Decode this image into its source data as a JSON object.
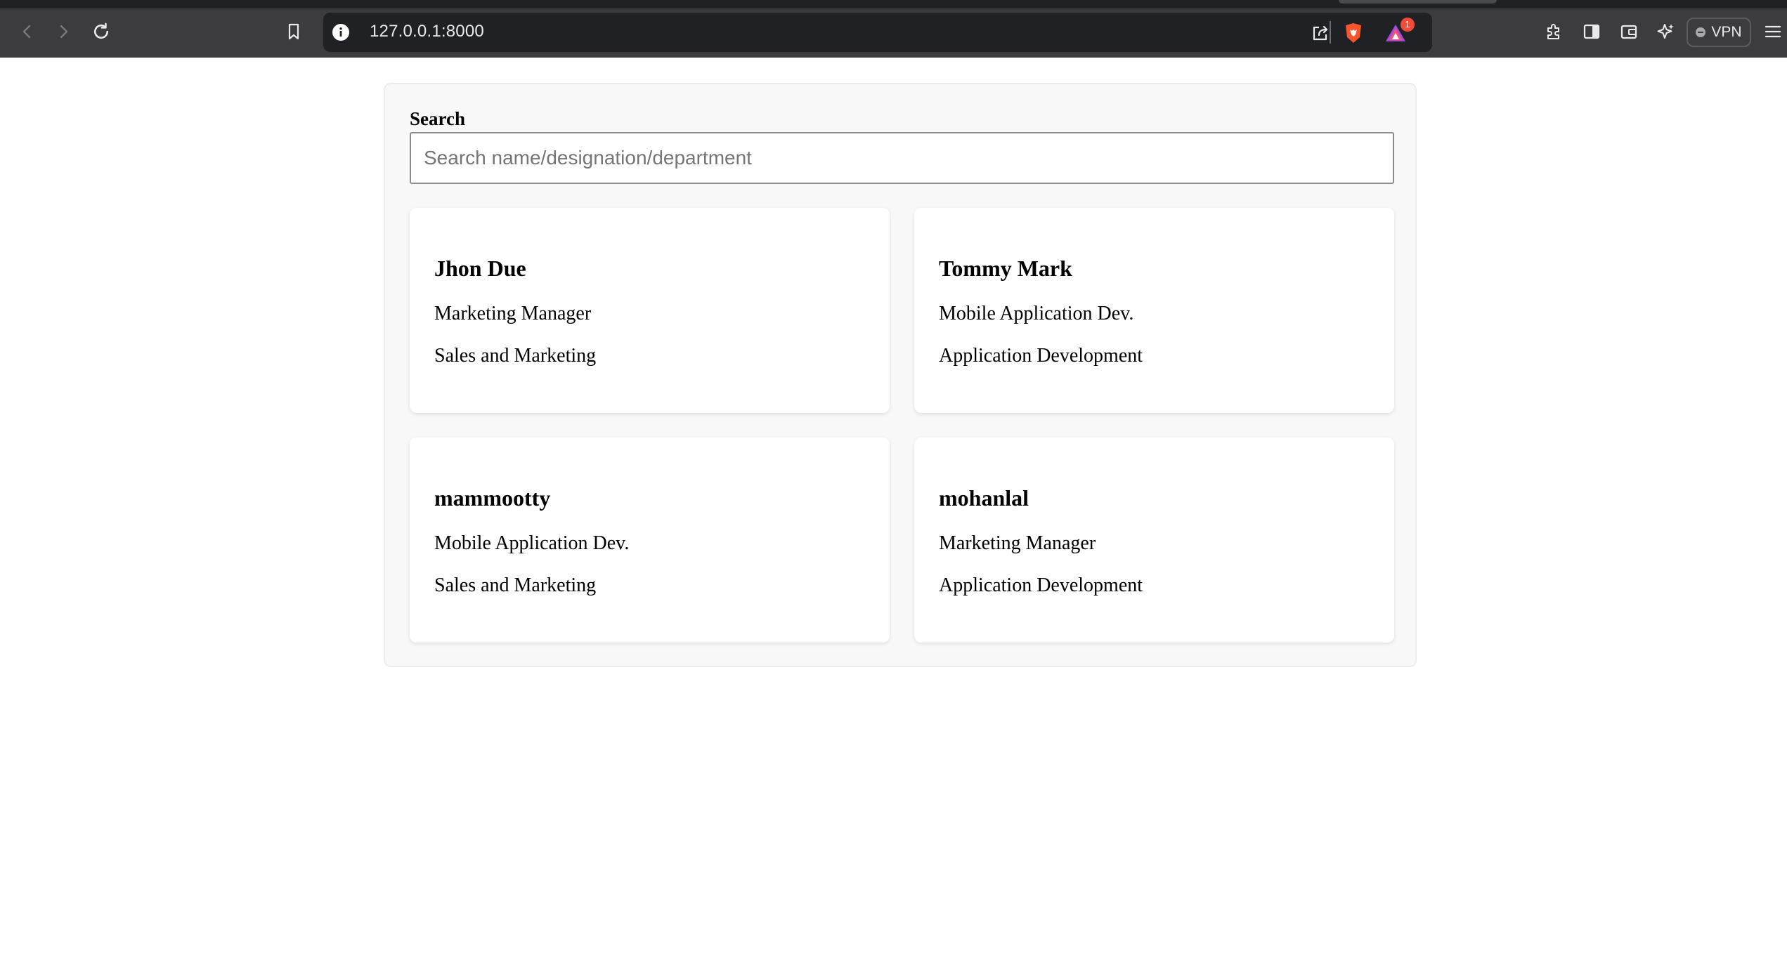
{
  "browser": {
    "url": "127.0.0.1:8000",
    "notification_count": "1",
    "vpn_label": "VPN",
    "colors": {
      "chrome_bg": "#3c3c3f",
      "urlbar_bg": "#202124",
      "brave_orange": "#fb542b",
      "badge_red": "#f34b3a"
    },
    "icons": [
      "back-icon",
      "forward-icon",
      "reload-icon",
      "bookmark-icon",
      "info-icon",
      "share-icon",
      "brave-shields-icon",
      "brave-rewards-icon",
      "extensions-icon",
      "sidebar-icon",
      "wallet-icon",
      "leo-ai-icon",
      "menu-icon"
    ]
  },
  "search": {
    "label": "Search",
    "placeholder": "Search name/designation/department",
    "value": ""
  },
  "employees": [
    {
      "name": "Jhon Due",
      "designation": "Marketing Manager",
      "department": "Sales and Marketing"
    },
    {
      "name": "Tommy Mark",
      "designation": "Mobile Application Dev.",
      "department": "Application Development"
    },
    {
      "name": "mammootty",
      "designation": "Mobile Application Dev.",
      "department": "Sales and Marketing"
    },
    {
      "name": "mohanlal",
      "designation": "Marketing Manager",
      "department": "Application Development"
    }
  ]
}
